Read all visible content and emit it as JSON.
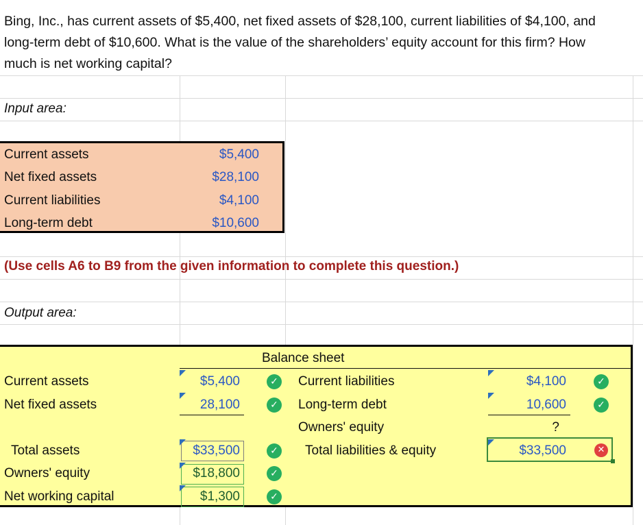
{
  "question": {
    "line1": "Bing, Inc., has current assets of $5,400, net fixed assets of $28,100, current liabilities of $4,100, and",
    "line2": "long-term debt of $10,600. What is the value of the shareholders’ equity account for this firm? How",
    "line3": "much is net working capital?"
  },
  "input_area": {
    "heading": "Input area:",
    "rows": [
      {
        "label": "Current assets",
        "value": "$5,400"
      },
      {
        "label": "Net fixed assets",
        "value": "$28,100"
      },
      {
        "label": "Current liabilities",
        "value": "$4,100"
      },
      {
        "label": "Long-term debt",
        "value": "$10,600"
      }
    ]
  },
  "note": "(Use cells A6 to B9 from the given information to complete this question.)",
  "output_area": {
    "heading": "Output area:",
    "balance_sheet_title": "Balance sheet",
    "left": {
      "current_assets_label": "Current assets",
      "current_assets_value": "$5,400",
      "net_fixed_assets_label": "Net fixed assets",
      "net_fixed_assets_value": "28,100",
      "total_assets_label": "Total assets",
      "total_assets_value": "$33,500",
      "owners_equity_label": "Owners' equity",
      "owners_equity_value": "$18,800",
      "nwc_label": "Net working capital",
      "nwc_value": "$1,300"
    },
    "right": {
      "current_liabilities_label": "Current liabilities",
      "current_liabilities_value": "$4,100",
      "ltd_label": "Long-term debt",
      "ltd_value": "10,600",
      "owners_equity_label": "Owners' equity",
      "owners_equity_value": "?",
      "total_label": "Total liabilities & equity",
      "total_value": "$33,500"
    }
  },
  "icons": {
    "correct": "check-circle-icon",
    "incorrect": "x-circle-icon"
  },
  "colors": {
    "input_fill": "#f8cbad",
    "output_fill": "#ffff9e",
    "value_blue": "#2a57c4",
    "note_red": "#a0201e",
    "check_green": "#27ae60",
    "error_red": "#e0403f"
  }
}
